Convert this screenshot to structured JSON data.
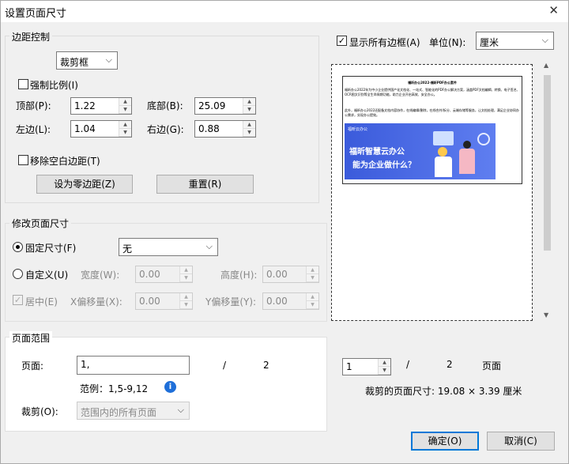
{
  "window": {
    "title": "设置页面尺寸"
  },
  "margin": {
    "group": "边距控制",
    "box_select": "裁剪框",
    "force_ratio": "强制比例(I)",
    "top_label": "顶部(P):",
    "top": "1.22",
    "bottom_label": "底部(B):",
    "bottom": "25.09",
    "left_label": "左边(L):",
    "left": "1.04",
    "right_label": "右边(G):",
    "right": "0.88",
    "remove_blank": "移除空白边距(T)",
    "zero_btn": "设为零边距(Z)",
    "reset_btn": "重置(R)"
  },
  "page_size": {
    "group": "修改页面尺寸",
    "fixed": "固定尺寸(F)",
    "fixed_value": "无",
    "custom": "自定义(U)",
    "width_label": "宽度(W):",
    "width": "0.00",
    "height_label": "高度(H):",
    "height": "0.00",
    "center": "居中(E)",
    "xoff_label": "X偏移量(X):",
    "xoff": "0.00",
    "yoff_label": "Y偏移量(Y):",
    "yoff": "0.00"
  },
  "range": {
    "group": "页面范围",
    "pages_label": "页面:",
    "pages_value": "1,",
    "slash": "/",
    "total": "2",
    "example": "范例：1,5-9,12",
    "crop_label": "裁剪(O):",
    "crop_value": "范围内的所有页面"
  },
  "top_right": {
    "show_all": "显示所有边框(A)",
    "unit_label": "单位(N):",
    "unit": "厘米"
  },
  "preview_doc": {
    "heading": "福昕办公2022-福昕PDF办公套件",
    "para1": "福昕办公2022年为中小企业提供国产化文档化、一站式、智能化的PDF办公解决方案，涵盖PDF文档编辑、转换、电子签名、OCR图文识别等全生命周期功能，助力企业开启高效、安全办公。",
    "para2": "此外，福昕办公2022还配备文档内容协作，在线编辑/删除，在线合并/拆分、云端存储等服务，让文档处理，满足企业协同办公需求，实现办公提效。",
    "banner_brand": "福昕云办公",
    "banner_line1": "福昕智慧云办公",
    "banner_line2": "能为企业做什么？"
  },
  "footer": {
    "page_value": "1",
    "slash": "/",
    "total": "2",
    "page_word": "页面",
    "crop_size": "裁剪的页面尺寸: 19.08 × 3.39  厘米",
    "ok": "确定(O)",
    "cancel": "取消(C)"
  },
  "colors": {
    "accent": "#0078d7",
    "banner": "#3b5bdb",
    "info": "#1e6fd9"
  }
}
